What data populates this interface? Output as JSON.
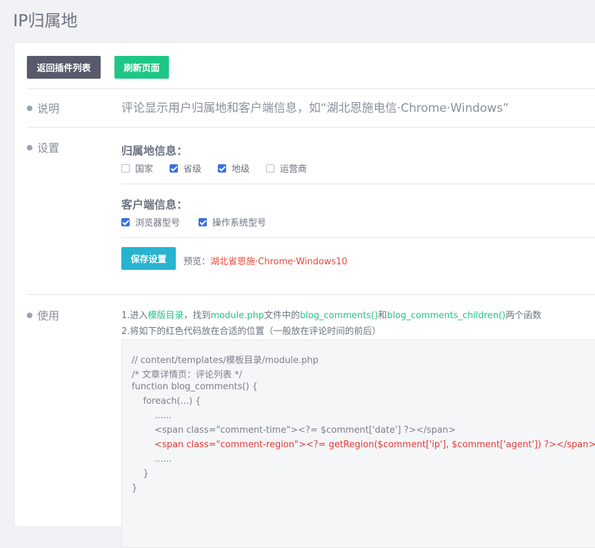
{
  "page": {
    "title": "IP归属地"
  },
  "toolbar": {
    "back_label": "返回插件列表",
    "refresh_label": "刷新页面"
  },
  "rows": {
    "desc_label": "说明",
    "settings_label": "设置",
    "usage_label": "使用"
  },
  "description": "评论显示用户归属地和客户端信息，如“湖北恩施电信·Chrome·Windows”",
  "settings": {
    "region_title": "归属地信息：",
    "region_options": [
      {
        "label": "国家",
        "checked": false
      },
      {
        "label": "省级",
        "checked": true
      },
      {
        "label": "地级",
        "checked": true
      },
      {
        "label": "运营商",
        "checked": false
      }
    ],
    "client_title": "客户端信息：",
    "client_options": [
      {
        "label": "浏览器型号",
        "checked": true
      },
      {
        "label": "操作系统型号",
        "checked": true
      }
    ],
    "save_label": "保存设置",
    "preview_label": "预览：",
    "preview_value": "湖北省恩施·Chrome·Windows10"
  },
  "usage": {
    "line1": {
      "p1": "1.进入",
      "link1": "模版目录",
      "p2": "，找到",
      "link2": "module.php",
      "p3": "文件中的",
      "link3": "blog_comments()",
      "p4": "和",
      "link4": "blog_comments_children()",
      "p5": "两个函数"
    },
    "line2": "2.将如下的红色代码放在合适的位置（一般放在评论时间的前后）",
    "code": [
      {
        "text": "// content/templates/模板目录/module.php",
        "red": false
      },
      {
        "text": "/* 文章详情页：评论列表 */",
        "red": false
      },
      {
        "text": "function blog_comments() {",
        "red": false
      },
      {
        "text": "    foreach(...) {",
        "red": false
      },
      {
        "text": "        ......",
        "red": false
      },
      {
        "text": "        <span class=\"comment-time\"><?= $comment['date'] ?></span>",
        "red": false
      },
      {
        "text": "        <span class=\"comment-region\"><?= getRegion($comment['ip'], $comment['agent']) ?></span>",
        "red": true
      },
      {
        "text": "        ......",
        "red": false
      },
      {
        "text": "    }",
        "red": false
      },
      {
        "text": "}",
        "red": false
      }
    ]
  },
  "colors": {
    "back_button": "#565a6a",
    "refresh_button": "#1ec785",
    "save_button": "#27b4d0",
    "checkbox_checked": "#3b6fe0",
    "preview_value": "#e64a3b",
    "link_green": "#1ec785",
    "code_red": "#e53935"
  }
}
